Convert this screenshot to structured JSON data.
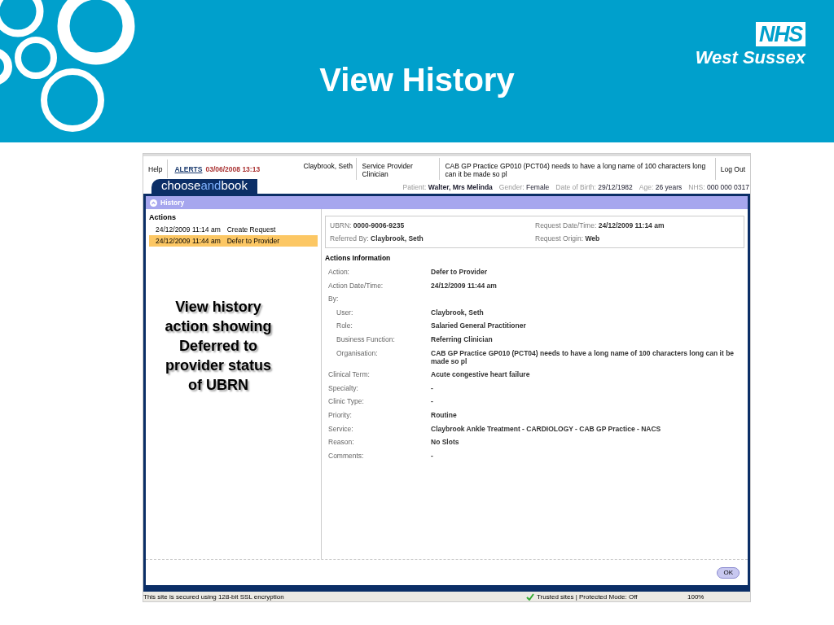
{
  "slide": {
    "title": "View History",
    "logo": {
      "badge": "NHS",
      "name": "West Sussex"
    }
  },
  "annotation": "View history action showing Deferred to provider status of UBRN",
  "app": {
    "top_bar": {
      "help": "Help",
      "alerts_label": "ALERTS",
      "alerts_time": "03/06/2008 13:13",
      "user": "Claybrook, Seth",
      "role": "Service Provider Clinician",
      "organisation": "CAB GP Practice GP010 (PCT04) needs to have a long name of 100 characters long can it be made so pl",
      "logout": "Log Out"
    },
    "brand": [
      {
        "text": "choose",
        "kind": "plain"
      },
      {
        "text": "and",
        "kind": "accent"
      },
      {
        "text": "book",
        "kind": "plain"
      }
    ],
    "patient": [
      {
        "label": "Patient:",
        "value": "Walter, Mrs Melinda",
        "kind": "bold"
      },
      {
        "label": "Gender:",
        "value": "Female",
        "kind": "plain"
      },
      {
        "label": "Date of Birth:",
        "value": "29/12/1982",
        "kind": "plain"
      },
      {
        "label": "Age:",
        "value": "26 years",
        "kind": "plain"
      },
      {
        "label": "NHS:",
        "value": "000 000 0317",
        "kind": "plain"
      }
    ],
    "panel_title": "History",
    "actions": {
      "heading": "Actions",
      "items": [
        {
          "time": "24/12/2009 11:14 am",
          "action": "Create Request",
          "selected": false
        },
        {
          "time": "24/12/2009 11:44 am",
          "action": "Defer to Provider",
          "selected": true
        }
      ]
    },
    "summary": [
      {
        "label": "UBRN:",
        "value": "0000-9006-9235"
      },
      {
        "label": "Request Date/Time:",
        "value": "24/12/2009 11:14 am"
      },
      {
        "label": "Referred By:",
        "value": "Claybrook, Seth"
      },
      {
        "label": "Request Origin:",
        "value": "Web"
      }
    ],
    "section_title": "Actions Information",
    "details": [
      {
        "label": "Action:",
        "value": "Defer to Provider"
      },
      {
        "label": "Action Date/Time:",
        "value": "24/12/2009 11:44 am"
      },
      {
        "label": "By:",
        "children": [
          {
            "label": "User:",
            "value": "Claybrook, Seth"
          },
          {
            "label": "Role:",
            "value": "Salaried General Practitioner"
          },
          {
            "label": "Business Function:",
            "value": "Referring Clinician"
          },
          {
            "label": "Organisation:",
            "value": "CAB GP Practice GP010 (PCT04) needs to have a long name of 100 characters long can it be made so pl"
          }
        ]
      },
      {
        "label": "Clinical Term:",
        "value": "Acute congestive heart failure"
      },
      {
        "label": "Specialty:",
        "value": "-"
      },
      {
        "label": "Clinic Type:",
        "value": "-"
      },
      {
        "label": "Priority:",
        "value": "Routine"
      },
      {
        "label": "Service:",
        "value": "Claybrook Ankle Treatment - CARDIOLOGY - CAB GP Practice - NACS"
      },
      {
        "label": "Reason:",
        "value": "No Slots"
      },
      {
        "label": "Comments:",
        "value": "-"
      }
    ],
    "ok_button": "OK",
    "status_bar": {
      "security": "This site is secured using 128-bit SSL encryption",
      "zone": "Trusted sites | Protected Mode: Off",
      "zoom": "100%"
    }
  }
}
